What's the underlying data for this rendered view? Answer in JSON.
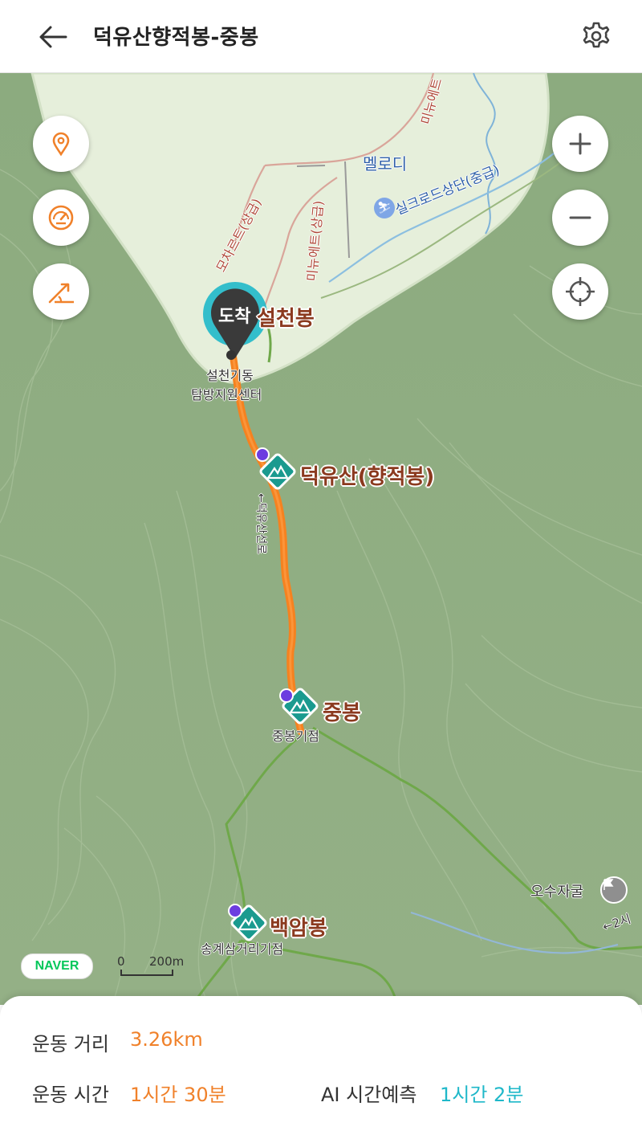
{
  "header": {
    "title": "덕유산향적봉-중봉",
    "back_icon": "arrow-left-icon",
    "settings_icon": "gear-icon"
  },
  "map": {
    "labels": {
      "marker": "도착",
      "seolcheon_peak": "설천봉",
      "trailhead_line1": "설천기동",
      "trailhead_line2": "탐방지원센터",
      "hyangjeok": "덕유산(향적봉)",
      "jungbong": "중봉",
      "jungbong_point": "중봉기점",
      "baegam": "백암봉",
      "songgye_point": "송계삼거리기점",
      "melody": "멜로디",
      "silk_road": "실크로드상단(중급)",
      "mocha_route": "모차르트(상급)",
      "mizart_route": "미뉴에트(상급)",
      "top_route": "미뉴에트",
      "osu_cave": "오수자굴",
      "edge_label": "←2시",
      "trail_vertical": "←덕유산선로"
    },
    "scale": {
      "zero": "0",
      "distance": "200m"
    },
    "brand": "NAVER",
    "colors": {
      "route": "#f58220",
      "peak_icon": "#1a9a8f",
      "accent": "#f0812a",
      "teal": "#1fb8c9"
    }
  },
  "controls": {
    "left": [
      "location-pin-icon",
      "speedometer-icon",
      "slope-icon"
    ],
    "right": [
      "zoom-in-icon",
      "zoom-out-icon",
      "crosshair-icon"
    ]
  },
  "stats": {
    "distance_label": "운동 거리",
    "distance_value": "3.26km",
    "time_label": "운동 시간",
    "time_value": "1시간 30분",
    "ai_label": "AI 시간예측",
    "ai_value": "1시간 2분"
  }
}
